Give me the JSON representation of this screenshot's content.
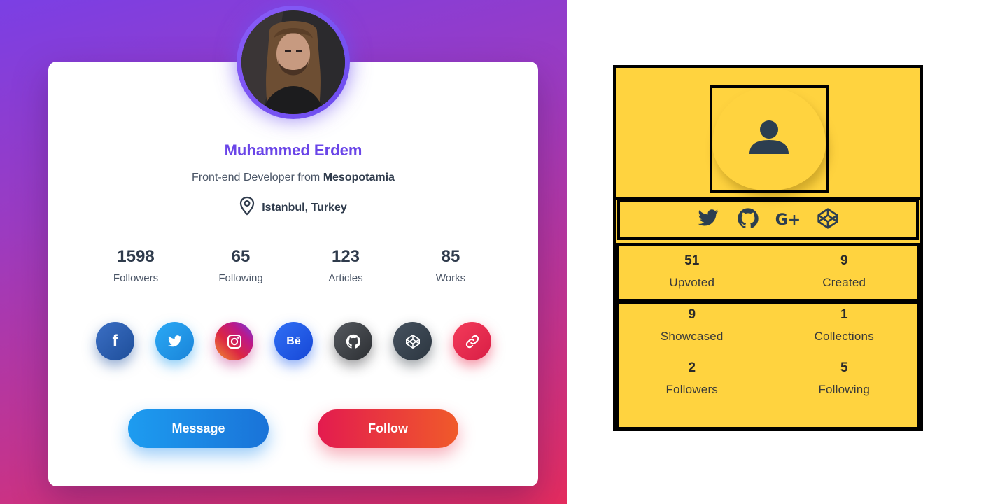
{
  "profile": {
    "name": "Muhammed Erdem",
    "role_prefix": "Front-end Developer from",
    "role_place": "Mesopotamia",
    "location": "Istanbul, Turkey",
    "stats": [
      {
        "value": "1598",
        "label": "Followers"
      },
      {
        "value": "65",
        "label": "Following"
      },
      {
        "value": "123",
        "label": "Articles"
      },
      {
        "value": "85",
        "label": "Works"
      }
    ],
    "socials": [
      {
        "name": "facebook-icon",
        "glyph": "f",
        "color": "#2d5ea8"
      },
      {
        "name": "twitter-icon",
        "glyph": "",
        "color": "#1d9cf0"
      },
      {
        "name": "instagram-icon",
        "glyph": "",
        "color": "#c13584"
      },
      {
        "name": "behance-icon",
        "glyph": "Bē",
        "color": "#1f5ff0"
      },
      {
        "name": "github-icon",
        "glyph": "",
        "color": "#3b3f45"
      },
      {
        "name": "codepen-icon",
        "glyph": "",
        "color": "#34404e"
      },
      {
        "name": "link-icon",
        "glyph": "",
        "color": "#ec2a4d"
      }
    ],
    "buttons": {
      "message": "Message",
      "follow": "Follow"
    }
  },
  "yellow_card": {
    "stats_row1": [
      {
        "value": "51",
        "label": "Upvoted"
      },
      {
        "value": "9",
        "label": "Created"
      }
    ],
    "stats_row2": [
      {
        "value": "9",
        "label": "Showcased"
      },
      {
        "value": "1",
        "label": "Collections"
      }
    ],
    "stats_row3": [
      {
        "value": "2",
        "label": "Followers"
      },
      {
        "value": "5",
        "label": "Following"
      }
    ],
    "social_icons": [
      "twitter-icon",
      "github-icon",
      "google-plus-icon",
      "codepen-icon"
    ],
    "google_plus_glyph": "G+"
  }
}
